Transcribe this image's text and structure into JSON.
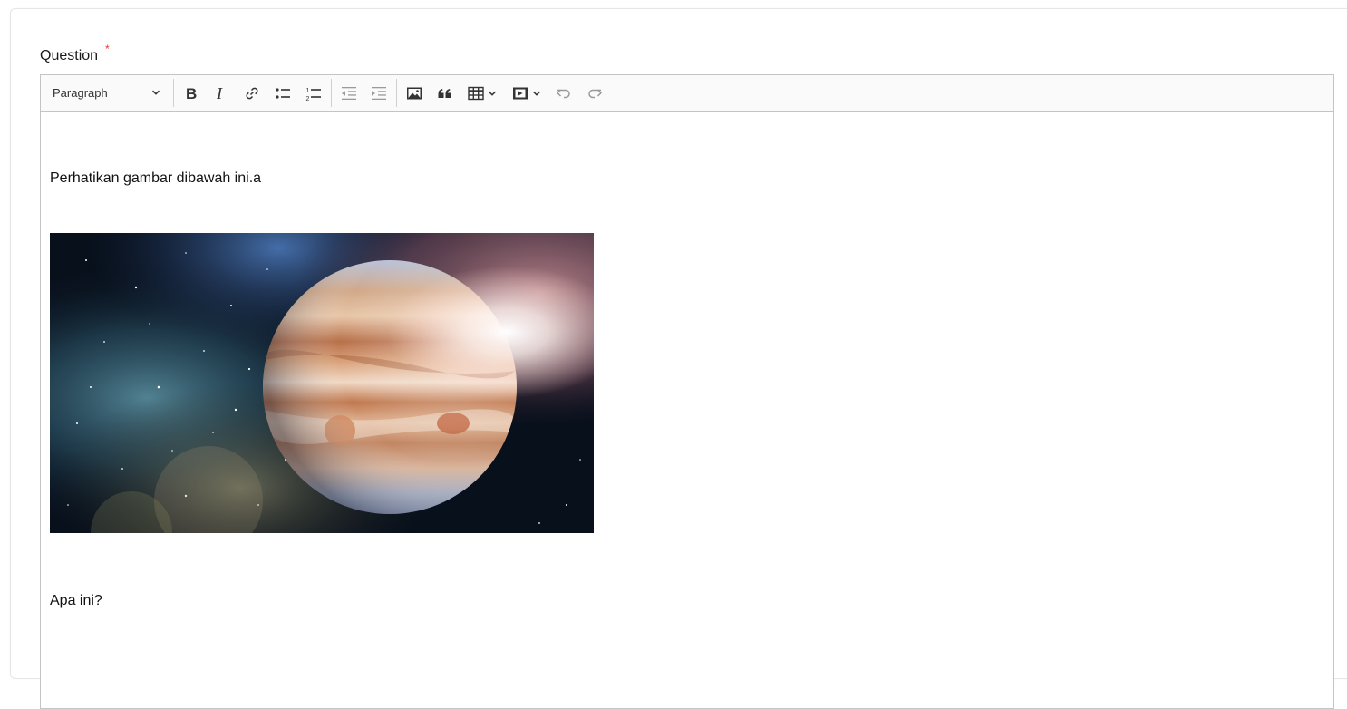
{
  "field": {
    "label": "Question",
    "required_mark": "*"
  },
  "toolbar": {
    "heading_dropdown": {
      "selected": "Paragraph",
      "icon": "chevron-down-icon"
    },
    "buttons": [
      {
        "name": "bold",
        "icon": "bold-icon"
      },
      {
        "name": "italic",
        "icon": "italic-icon"
      },
      {
        "name": "link",
        "icon": "link-icon"
      },
      {
        "name": "bulleted-list",
        "icon": "bulleted-list-icon"
      },
      {
        "name": "numbered-list",
        "icon": "numbered-list-icon"
      },
      {
        "name": "outdent",
        "icon": "outdent-icon"
      },
      {
        "name": "indent",
        "icon": "indent-icon"
      },
      {
        "name": "insert-image",
        "icon": "image-icon"
      },
      {
        "name": "block-quote",
        "icon": "quote-icon"
      },
      {
        "name": "insert-table",
        "icon": "table-icon"
      },
      {
        "name": "insert-media",
        "icon": "media-icon"
      },
      {
        "name": "undo",
        "icon": "undo-icon"
      },
      {
        "name": "redo",
        "icon": "redo-icon"
      }
    ]
  },
  "content": {
    "paragraph_1": "Perhatikan gambar dibawah ini.a",
    "image": {
      "subject": "planet Jupiter in space with nebula and stars",
      "icon": "planet-image"
    },
    "paragraph_2": "Apa ini?"
  },
  "colors": {
    "required": "#e53935",
    "toolbar_bg": "#fafafa",
    "border": "#c4c4c4",
    "icon": "#333333",
    "icon_disabled": "#9a9a9a"
  }
}
